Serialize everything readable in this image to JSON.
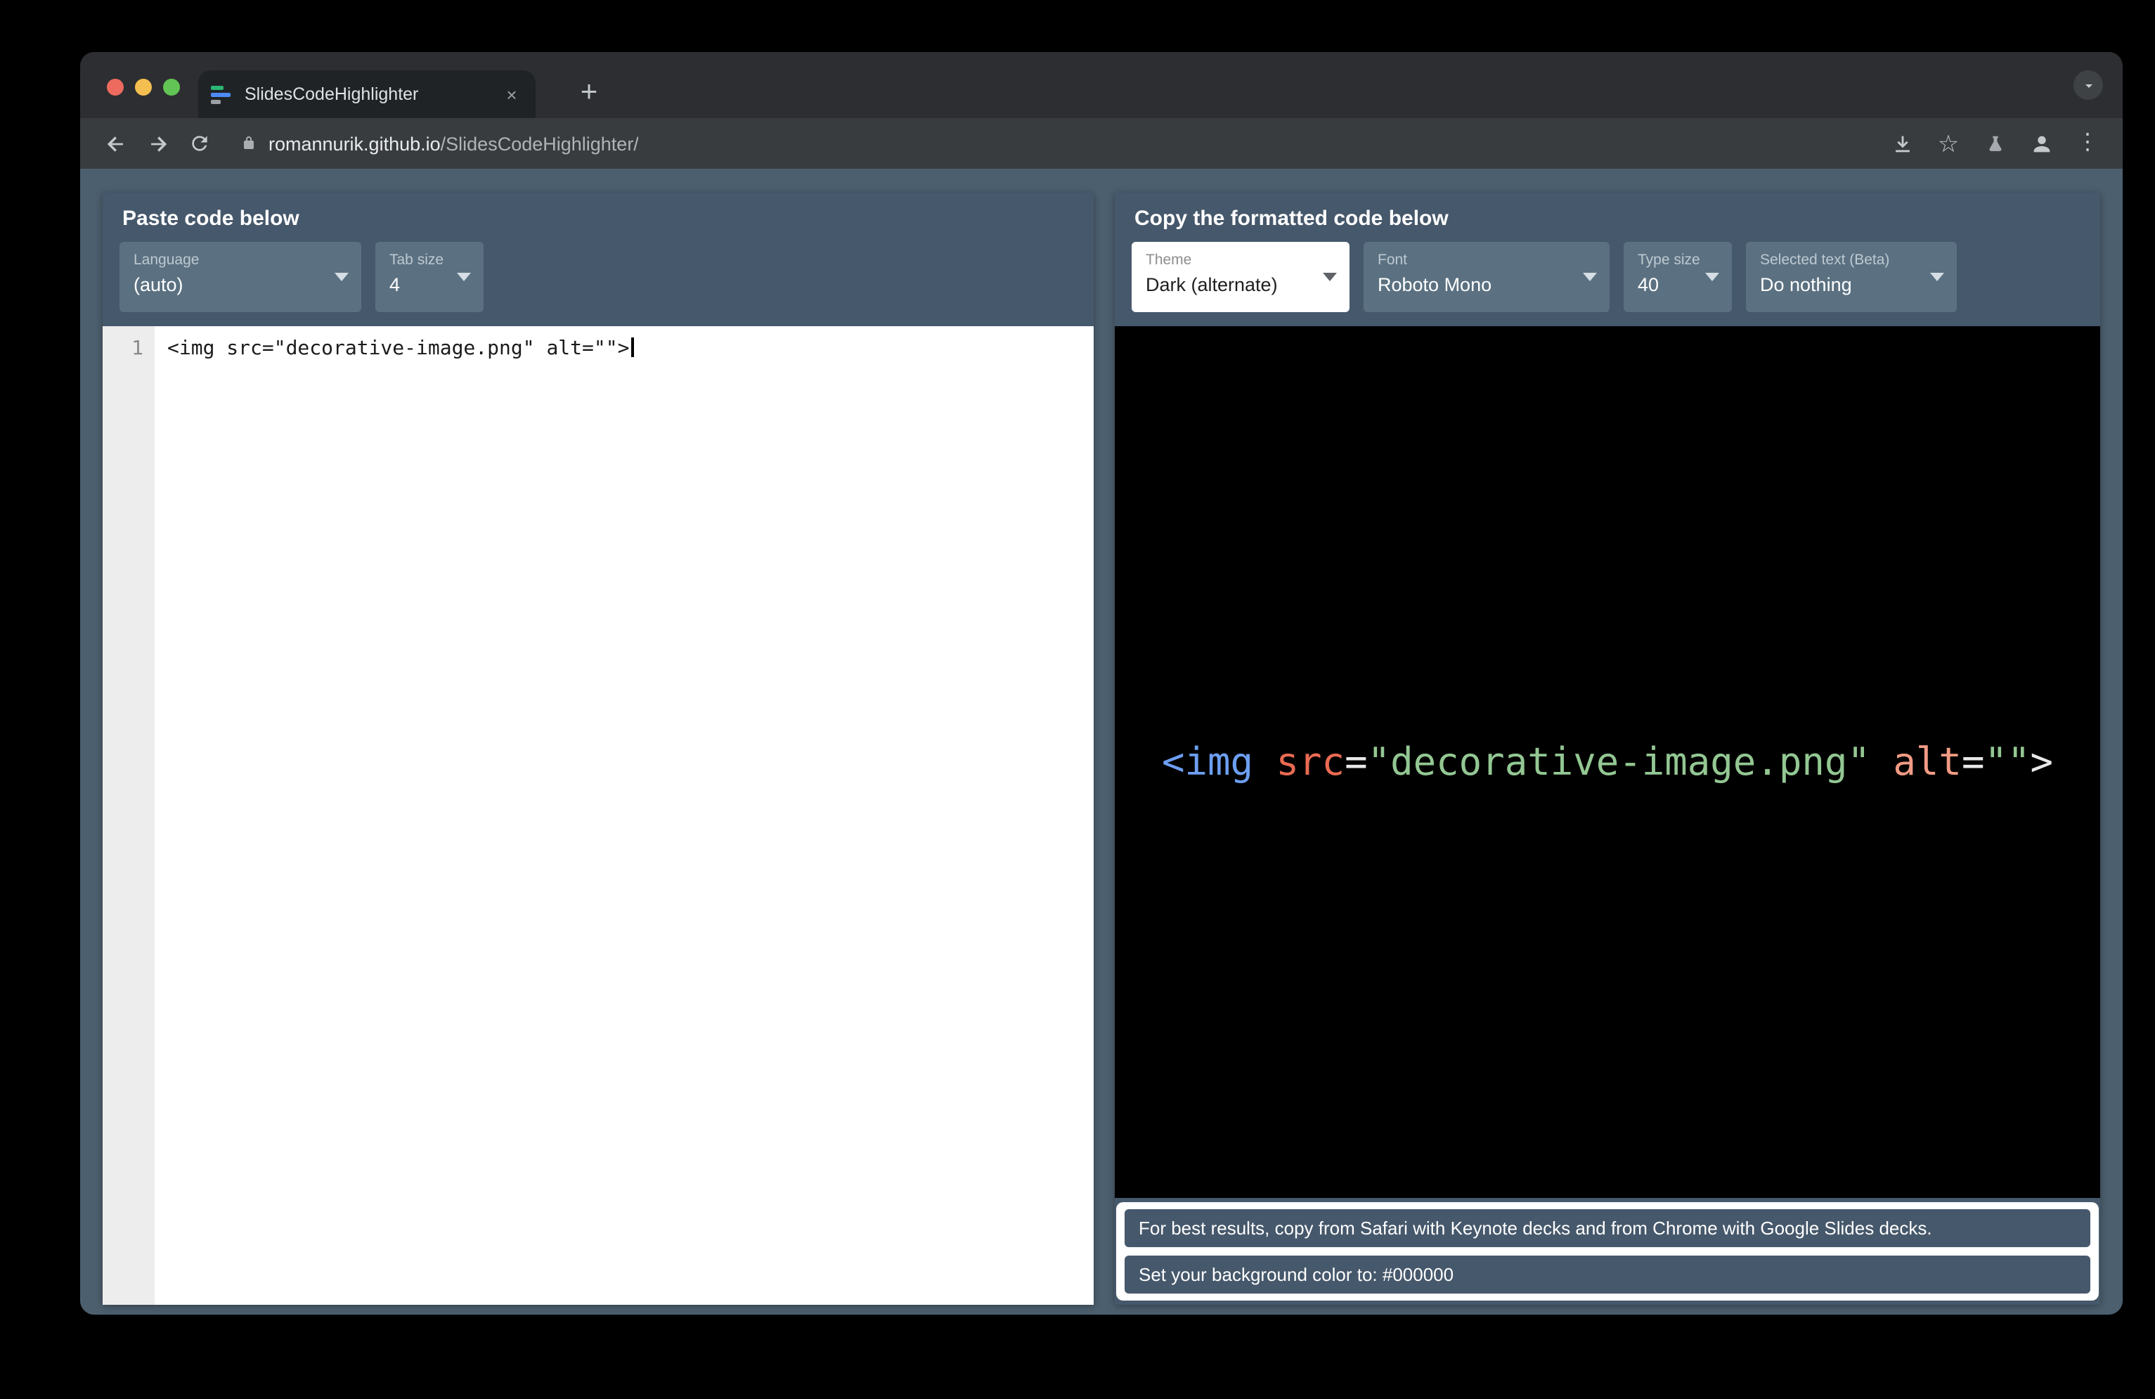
{
  "browser": {
    "tab_title": "SlidesCodeHighlighter",
    "url_domain": "romannurik.github.io",
    "url_path": "/SlidesCodeHighlighter/"
  },
  "icons": {
    "tab_close": "×",
    "new_tab": "+",
    "star": "☆",
    "kebab": "⋮"
  },
  "left": {
    "title": "Paste code below",
    "language_label": "Language",
    "language_value": "(auto)",
    "tabsize_label": "Tab size",
    "tabsize_value": "4",
    "line_number": "1",
    "code": "<img src=\"decorative-image.png\" alt=\"\">"
  },
  "right": {
    "title": "Copy the formatted code below",
    "theme_label": "Theme",
    "theme_value": "Dark (alternate)",
    "font_label": "Font",
    "font_value": "Roboto Mono",
    "typesize_label": "Type size",
    "typesize_value": "40",
    "selectedtext_label": "Selected text (Beta)",
    "selectedtext_value": "Do nothing",
    "preview_tokens": [
      {
        "text": "<img",
        "color": "#6D9FF2"
      },
      {
        "text": " ",
        "color": "#FFFFFF"
      },
      {
        "text": "src",
        "color": "#EA6A52"
      },
      {
        "text": "=",
        "color": "#E8E8E8"
      },
      {
        "text": "\"decorative-image.png\"",
        "color": "#93C793"
      },
      {
        "text": " ",
        "color": "#FFFFFF"
      },
      {
        "text": "alt",
        "color": "#F29B84"
      },
      {
        "text": "=",
        "color": "#E8E8E8"
      },
      {
        "text": "\"\"",
        "color": "#93C793"
      },
      {
        "text": ">",
        "color": "#E8E8E8"
      }
    ],
    "messages": [
      "For best results, copy from Safari with Keynote decks and from Chrome with Google Slides decks.",
      "Set your background color to: #000000"
    ]
  },
  "colors": {
    "page_background": "#4C5F6E",
    "panel_background": "#46586B",
    "dropdown_background": "#5B7181",
    "preview_background": "#000000",
    "editor_background": "#FFFFFF"
  }
}
